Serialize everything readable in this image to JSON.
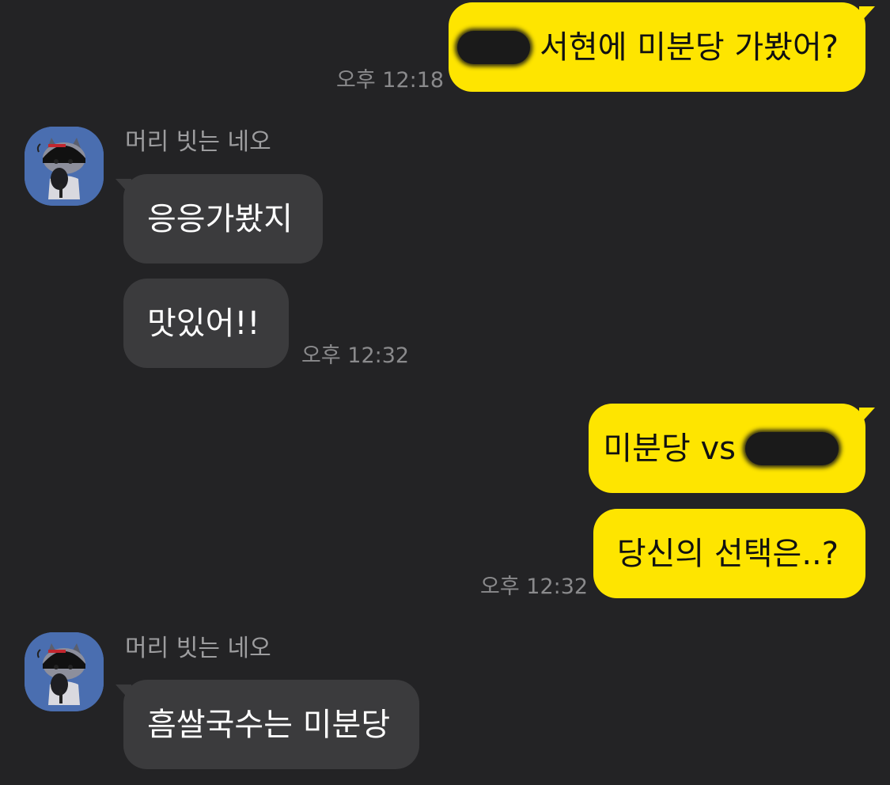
{
  "colors": {
    "background": "#232325",
    "my_bubble": "#FEE500",
    "their_bubble": "#3B3B3D",
    "avatar_bg": "#4A6EB0",
    "timestamp": "#8A8A8C"
  },
  "messages": [
    {
      "id": "m1",
      "from": "me",
      "text": "서현에 미분당 가봤어?",
      "has_redaction": true,
      "time": "오후 12:18"
    },
    {
      "id": "m2",
      "from": "them",
      "sender": "머리 빗는 네오",
      "text": "응응가봤지"
    },
    {
      "id": "m3",
      "from": "them",
      "text": "맛있어!!",
      "time": "오후 12:32"
    },
    {
      "id": "m4",
      "from": "me",
      "text": "미분당 vs",
      "has_redaction": true
    },
    {
      "id": "m5",
      "from": "me",
      "text": "당신의 선택은..?",
      "time": "오후 12:32"
    },
    {
      "id": "m6",
      "from": "them",
      "sender": "머리 빗는 네오",
      "text": "흠쌀국수는 미분당"
    }
  ],
  "avatar": {
    "icon": "neo-character-icon"
  }
}
